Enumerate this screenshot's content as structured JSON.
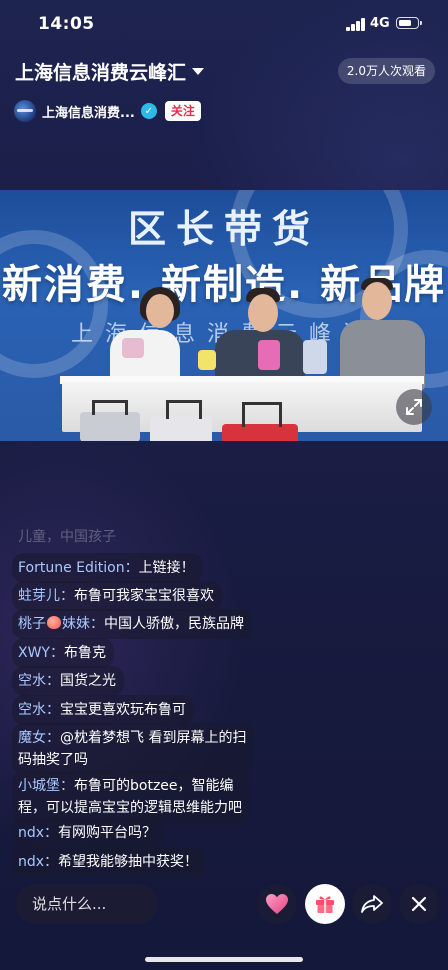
{
  "status_bar": {
    "time": "14:05",
    "network": "4G",
    "battery_level": 0.7
  },
  "header": {
    "title": "上海信息消费云峰汇",
    "viewers": "2.0万人次观看"
  },
  "channel": {
    "name": "上海信息消费...",
    "verified_icon": "check-icon",
    "follow_label": "关注"
  },
  "video": {
    "title": "区长带货",
    "subtitle": "新消费. 新制造. 新品牌",
    "org": "上海信息消费云峰汇",
    "expand_icon": "expand-arrows-icon"
  },
  "chat": {
    "faded_text": "儿童，中国孩子",
    "messages": [
      {
        "user": "Fortune Edition：",
        "text": "上链接！"
      },
      {
        "user": "蛀芽儿：",
        "text": "布鲁可我家宝宝很喜欢"
      },
      {
        "user_prefix": "桃子",
        "user_suffix": "妹妹：",
        "text": "中国人骄傲，民族品牌"
      },
      {
        "user": "XWY：",
        "text": "布鲁克"
      },
      {
        "user": "空水：",
        "text": "国货之光"
      },
      {
        "user": "空水：",
        "text": "宝宝更喜欢玩布鲁可"
      },
      {
        "user": "魔女：",
        "text": "@枕着梦想飞 看到屏幕上的扫",
        "text2": "码抽奖了吗"
      },
      {
        "user": "小城堡：",
        "text": "布鲁可的botzee，智能编",
        "text2": "程，可以提高宝宝的逻辑思维能力吧"
      },
      {
        "user": "ndx：",
        "text": "有网购平台吗？"
      },
      {
        "user": "ndx：",
        "text": "希望我能够抽中获奖！"
      }
    ]
  },
  "bottom_bar": {
    "comment_placeholder": "说点什么...",
    "like_icon": "heart-icon",
    "gift_icon": "gift-icon",
    "share_icon": "share-icon",
    "close_icon": "close-icon"
  },
  "colors": {
    "follow_text": "#f2294a",
    "username": "#a9c8ff",
    "verified": "#2fb9e8"
  }
}
